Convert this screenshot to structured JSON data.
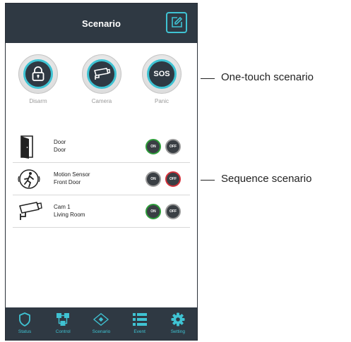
{
  "header": {
    "title": "Scenario",
    "edit_icon": "edit-icon"
  },
  "one_touch": [
    {
      "label": "Disarm",
      "icon": "lock-icon"
    },
    {
      "label": "Camera",
      "icon": "camera-icon"
    },
    {
      "label": "Panic",
      "icon": "sos-icon",
      "text": "SOS"
    }
  ],
  "sequence": [
    {
      "name": "Door",
      "location": "Door",
      "icon": "door-icon",
      "state": "on"
    },
    {
      "name": "Motion Sensor",
      "location": "Front Door",
      "icon": "motion-sensor-icon",
      "state": "off"
    },
    {
      "name": "Cam 1",
      "location": "Living Room",
      "icon": "camera-icon",
      "state": "on"
    }
  ],
  "toggle": {
    "on": "ON",
    "off": "OFF"
  },
  "nav": [
    {
      "label": "Status",
      "icon": "shield-icon"
    },
    {
      "label": "Control",
      "icon": "control-icon"
    },
    {
      "label": "Scenario",
      "icon": "scenario-icon"
    },
    {
      "label": "Event",
      "icon": "list-icon"
    },
    {
      "label": "Setting",
      "icon": "gear-icon"
    }
  ],
  "callouts": {
    "one_touch": "One-touch scenario",
    "sequence": "Sequence scenario"
  },
  "colors": {
    "header": "#2f3943",
    "accent": "#3fc3d3",
    "on_ring": "#2e9c3a",
    "off_ring": "#d2313a"
  }
}
